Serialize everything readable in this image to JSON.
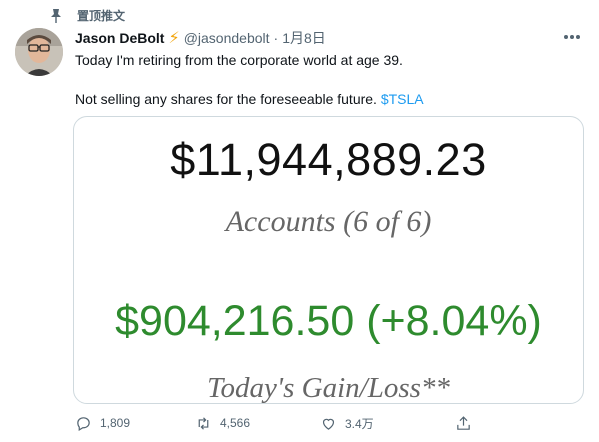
{
  "pinned": {
    "label": "置顶推文",
    "icon": "pin-icon"
  },
  "tweet": {
    "author_name": "Jason DeBolt",
    "badge_icon": "lightning-bolt-icon",
    "handle": "@jasondebolt",
    "separator": "·",
    "date": "1月8日",
    "line1": "Today I'm retiring from the corporate world at age 39.",
    "line2": "Not selling any shares for the foreseeable future.",
    "cashtag": "$TSLA"
  },
  "card": {
    "balance": "$11,944,889.23",
    "accounts_label": "Accounts (6 of 6)",
    "gain": "$904,216.50 (+8.04%)",
    "gain_label": "Today's Gain/Loss**",
    "gain_color": "#2e8b2e"
  },
  "actions": {
    "reply_count": "1,809",
    "retweet_count": "4,566",
    "like_count": "3.4万"
  },
  "colors": {
    "accent": "#1d9bf0",
    "bolt": "#f2a60f",
    "muted": "#536471"
  }
}
